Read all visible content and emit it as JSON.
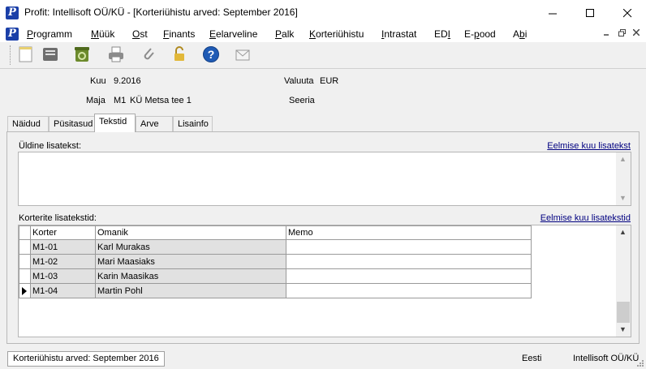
{
  "window": {
    "title": "Profit: Intellisoft OÜ/KÜ - [Korteriühistu arved: September 2016]",
    "logo_letter": "P"
  },
  "menu": [
    {
      "label": "Programm",
      "accel": "P",
      "rest": "rogramm"
    },
    {
      "label": "Müük",
      "accel": "M",
      "rest": "üük"
    },
    {
      "label": "Ost",
      "accel": "O",
      "rest": "st"
    },
    {
      "label": "Finants",
      "accel": "F",
      "rest": "inants"
    },
    {
      "label": "Eelarveline",
      "accel": "E",
      "rest": "elarveline"
    },
    {
      "label": "Palk",
      "accel": "P",
      "rest": "alk"
    },
    {
      "label": "Korteriühistu",
      "accel": "K",
      "rest": "orteriühistu"
    },
    {
      "label": "Intrastat",
      "accel": "I",
      "rest": "ntrastat"
    },
    {
      "label": "EDI",
      "pre": "ED",
      "accel": "I",
      "rest": ""
    },
    {
      "label": "E-pood",
      "pre": "E-",
      "accel": "p",
      "rest": "ood"
    },
    {
      "label": "Abi",
      "pre": "A",
      "accel": "b",
      "rest": "i"
    }
  ],
  "toolbar": {
    "icons": [
      "new-document-icon",
      "save-icon",
      "recycle-icon",
      "print-icon",
      "attach-icon",
      "unlock-icon",
      "help-icon",
      "email-icon"
    ]
  },
  "header": {
    "kuu_label": "Kuu",
    "kuu_value": "9.2016",
    "valuuta_label": "Valuuta",
    "valuuta_value": "EUR",
    "maja_label": "Maja",
    "maja_code": "M1",
    "maja_name": "KÜ Metsa tee 1",
    "seeria_label": "Seeria"
  },
  "tabs": [
    {
      "label": "Näidud",
      "active": false
    },
    {
      "label": "Püsitasud",
      "active": false
    },
    {
      "label": "Tekstid",
      "active": true
    },
    {
      "label": "Arve",
      "active": false
    },
    {
      "label": "Lisainfo",
      "active": false
    }
  ],
  "general": {
    "label": "Üldine lisatekst:",
    "prev_link": "Eelmise kuu lisatekst",
    "value": ""
  },
  "apartments": {
    "label": "Korterite lisatekstid:",
    "prev_link": "Eelmise kuu lisatekstid",
    "columns": [
      "Korter",
      "Omanik",
      "Memo"
    ],
    "rows": [
      {
        "korter": "M1-01",
        "omanik": "Karl Murakas",
        "memo": ""
      },
      {
        "korter": "M1-02",
        "omanik": "Mari Maasiaks",
        "memo": ""
      },
      {
        "korter": "M1-03",
        "omanik": "Karin Maasikas",
        "memo": ""
      },
      {
        "korter": "M1-04",
        "omanik": "Martin Pohl",
        "memo": ""
      }
    ],
    "current_row": 3
  },
  "status": {
    "document": "Korteriühistu arved: September 2016",
    "language": "Eesti",
    "company": "Intellisoft OÜ/KÜ"
  }
}
